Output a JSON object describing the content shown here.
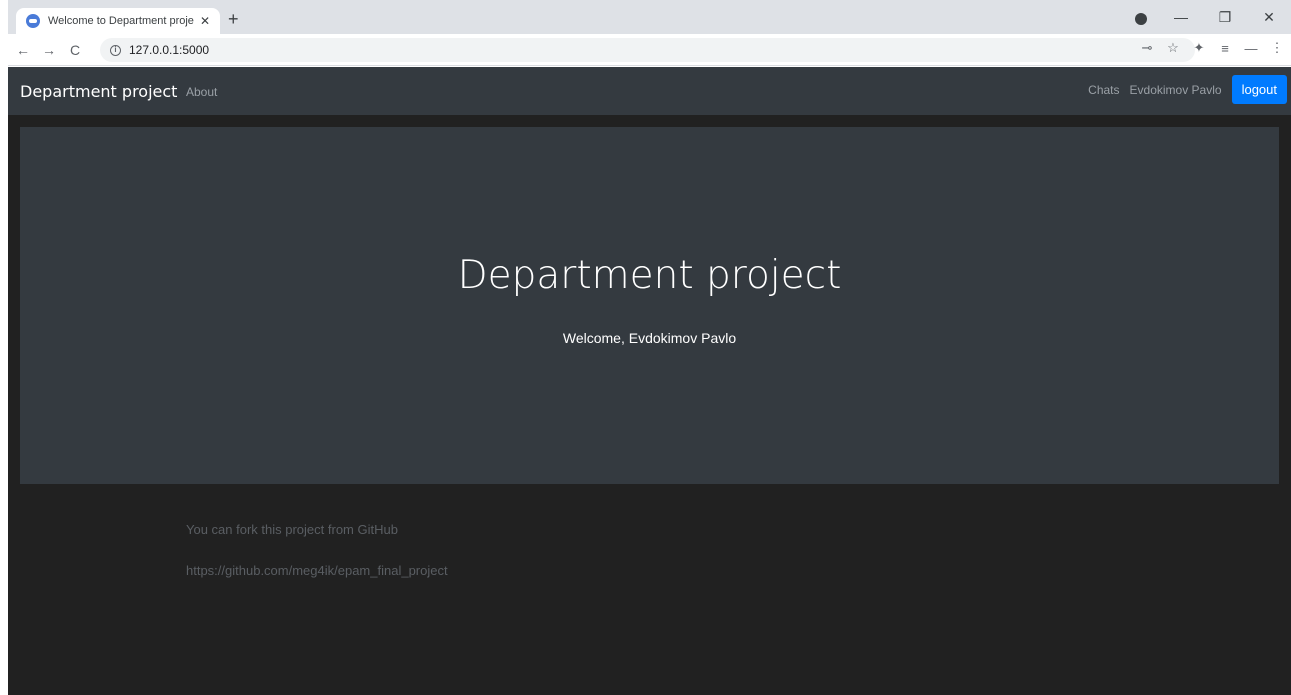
{
  "browser": {
    "tab_title": "Welcome to Department project",
    "tab_close": "✕",
    "new_tab": "+",
    "url": "127.0.0.1:5000",
    "info_glyph": "i",
    "nav": {
      "back": "←",
      "forward": "→",
      "reload": "C"
    },
    "window_controls": {
      "minimize": "—",
      "restore": "❐",
      "close": "✕"
    },
    "toolbar_icons": [
      "key-icon",
      "star-icon",
      "puzzle-icon",
      "queue-icon",
      "minus-icon",
      "menu-icon"
    ],
    "toolbar_glyphs": {
      "key": "⊸",
      "star": "☆",
      "puzzle": "✦",
      "queue": "≡",
      "minus": "—",
      "menu": "⋮"
    }
  },
  "navbar": {
    "brand": "Department project",
    "about": "About",
    "chats": "Chats",
    "user": "Evdokimov Pavlo",
    "logout": "logout"
  },
  "jumbotron": {
    "title": "Department project",
    "subtitle": "Welcome, Evdokimov Pavlo"
  },
  "footer": {
    "fork_text": "You can fork this project from GitHub",
    "github_url": "https://github.com/meg4ik/epam_final_project"
  },
  "colors": {
    "page_bg": "#212121",
    "navbar_bg": "#343a40",
    "jumbotron_bg": "#343a40",
    "button_primary": "#007bff",
    "muted_text": "#5a5e63"
  }
}
